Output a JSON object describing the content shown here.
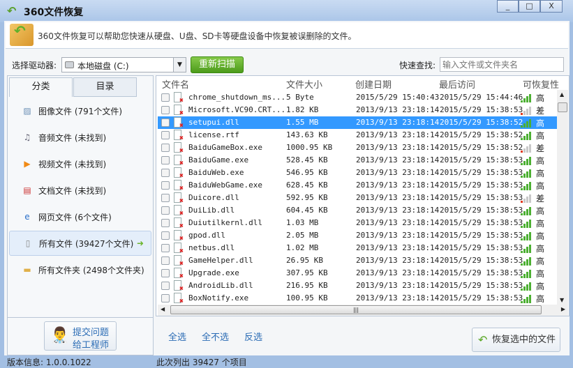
{
  "window": {
    "title": "360文件恢复",
    "minimize": "_",
    "maximize": "□",
    "close": "X"
  },
  "banner": {
    "text": "360文件恢复可以帮助您快速从硬盘、U盘、SD卡等硬盘设备中恢复被误删除的文件。"
  },
  "toolbar": {
    "drive_label": "选择驱动器:",
    "drive_value": "本地磁盘 (C:)",
    "rescan": "重新扫描",
    "search_label": "快速查找:",
    "search_placeholder": "输入文件或文件夹名"
  },
  "left": {
    "tabs": [
      "分类",
      "目录"
    ],
    "categories": [
      {
        "label": "图像文件 (791个文件)",
        "icon": "image-icon"
      },
      {
        "label": "音频文件 (未找到)",
        "icon": "music-icon"
      },
      {
        "label": "视频文件 (未找到)",
        "icon": "video-icon"
      },
      {
        "label": "文档文件 (未找到)",
        "icon": "document-icon"
      },
      {
        "label": "网页文件 (6个文件)",
        "icon": "ie-icon"
      },
      {
        "label": "所有文件 (39427个文件)",
        "icon": "file-icon",
        "selected": true
      },
      {
        "label": "所有文件夹 (2498个文件夹)",
        "icon": "folder-icon"
      }
    ],
    "feedback": [
      "提交问题",
      "给工程师"
    ]
  },
  "table": {
    "headers": [
      "文件名",
      "文件大小",
      "创建日期",
      "最后访问",
      "可恢复性"
    ],
    "rows": [
      {
        "name": "chrome_shutdown_ms...",
        "size": "5 Byte",
        "created": "2015/5/29 15:40:43",
        "accessed": "2015/5/29 15:44:46",
        "rec": "高"
      },
      {
        "name": "Microsoft.VC90.CRT...",
        "size": "1.82 KB",
        "created": "2013/9/13 23:18:14",
        "accessed": "2015/5/29 15:38:53",
        "rec": "差"
      },
      {
        "name": "setupui.dll",
        "size": "1.55 MB",
        "created": "2013/9/13 23:18:14",
        "accessed": "2015/5/29 15:38:52",
        "rec": "高",
        "selected": true
      },
      {
        "name": "license.rtf",
        "size": "143.63 KB",
        "created": "2013/9/13 23:18:14",
        "accessed": "2015/5/29 15:38:52",
        "rec": "高"
      },
      {
        "name": "BaiduGameBox.exe",
        "size": "1000.95 KB",
        "created": "2013/9/13 23:18:14",
        "accessed": "2015/5/29 15:38:52",
        "rec": "差"
      },
      {
        "name": "BaiduGame.exe",
        "size": "528.45 KB",
        "created": "2013/9/13 23:18:14",
        "accessed": "2015/5/29 15:38:53",
        "rec": "高"
      },
      {
        "name": "BaiduWeb.exe",
        "size": "546.95 KB",
        "created": "2013/9/13 23:18:14",
        "accessed": "2015/5/29 15:38:53",
        "rec": "高"
      },
      {
        "name": "BaiduWebGame.exe",
        "size": "628.45 KB",
        "created": "2013/9/13 23:18:14",
        "accessed": "2015/5/29 15:38:53",
        "rec": "高"
      },
      {
        "name": "Duicore.dll",
        "size": "592.95 KB",
        "created": "2013/9/13 23:18:14",
        "accessed": "2015/5/29 15:38:53",
        "rec": "差"
      },
      {
        "name": "DuiLib.dll",
        "size": "604.45 KB",
        "created": "2013/9/13 23:18:14",
        "accessed": "2015/5/29 15:38:53",
        "rec": "高"
      },
      {
        "name": "Duiutilkernl.dll",
        "size": "1.03 MB",
        "created": "2013/9/13 23:18:14",
        "accessed": "2015/5/29 15:38:53",
        "rec": "高"
      },
      {
        "name": "gpod.dll",
        "size": "2.05 MB",
        "created": "2013/9/13 23:18:14",
        "accessed": "2015/5/29 15:38:53",
        "rec": "高"
      },
      {
        "name": "netbus.dll",
        "size": "1.02 MB",
        "created": "2013/9/13 23:18:14",
        "accessed": "2015/5/29 15:38:53",
        "rec": "高"
      },
      {
        "name": "GameHelper.dll",
        "size": "26.95 KB",
        "created": "2013/9/13 23:18:14",
        "accessed": "2015/5/29 15:38:53",
        "rec": "高"
      },
      {
        "name": "Upgrade.exe",
        "size": "307.95 KB",
        "created": "2013/9/13 23:18:14",
        "accessed": "2015/5/29 15:38:53",
        "rec": "高"
      },
      {
        "name": "AndroidLib.dll",
        "size": "216.95 KB",
        "created": "2013/9/13 23:18:14",
        "accessed": "2015/5/29 15:38:53",
        "rec": "高"
      },
      {
        "name": "BoxNotify.exe",
        "size": "100.95 KB",
        "created": "2013/9/13 23:18:14",
        "accessed": "2015/5/29 15:38:53",
        "rec": "高"
      }
    ]
  },
  "actions": {
    "select_all": "全选",
    "select_none": "全不选",
    "invert": "反选",
    "restore": "恢复选中的文件"
  },
  "status": {
    "version": "版本信息: 1.0.0.1022",
    "count": "此次列出 39427 个项目"
  },
  "colors": {
    "high": "#4caf32",
    "low": "#e03a1e",
    "selection": "#3399ff",
    "rescan": "#5aa724"
  }
}
